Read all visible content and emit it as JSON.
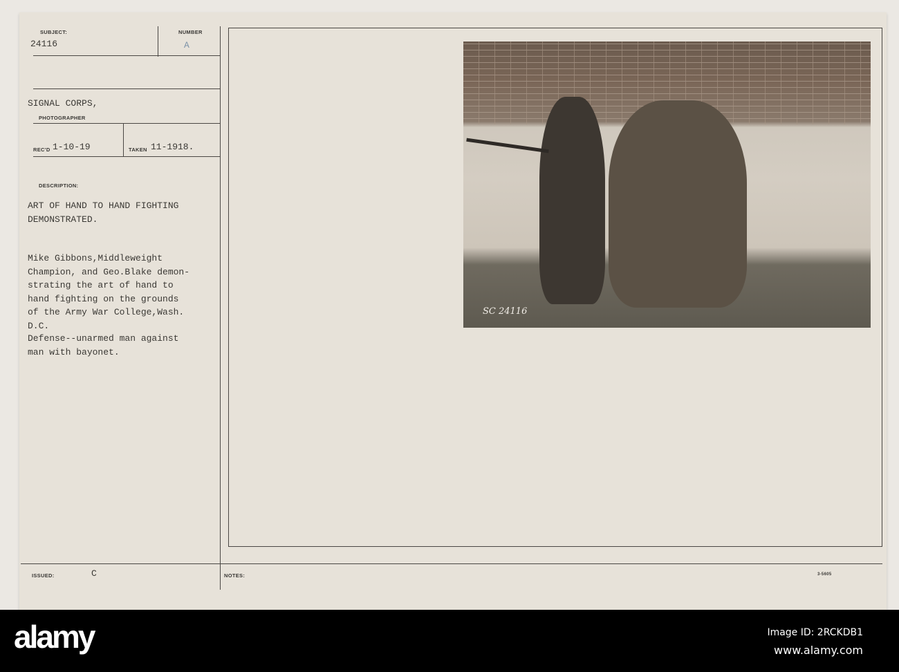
{
  "card": {
    "subject_label": "SUBJECT:",
    "subject_value": "24116",
    "number_label": "NUMBER",
    "number_value": "A",
    "photographer_value": "SIGNAL CORPS,",
    "photographer_label": "PHOTOGRAPHER",
    "recd_label": "REC'D",
    "recd_value": "1-10-19",
    "taken_label": "TAKEN",
    "taken_value": "11-1918.",
    "description_label": "DESCRIPTION:",
    "description_title": "ART OF HAND TO HAND FIGHTING\nDEMONSTRATED.",
    "description_body": "Mike Gibbons,Middleweight\nChampion, and Geo.Blake demon-\nstrating the art of hand to\nhand fighting on the grounds\nof the Army War College,Wash.\nD.C.",
    "description_note": "Defense--unarmed man against\nman with bayonet.",
    "issued_label": "ISSUED:",
    "issued_value": "C",
    "notes_label": "NOTES:",
    "form_code": "3-5605",
    "photo_number": "SC 24116"
  },
  "footer": {
    "logo": "alamy",
    "image_id": "Image ID: 2RCKDB1",
    "url": "www.alamy.com"
  }
}
